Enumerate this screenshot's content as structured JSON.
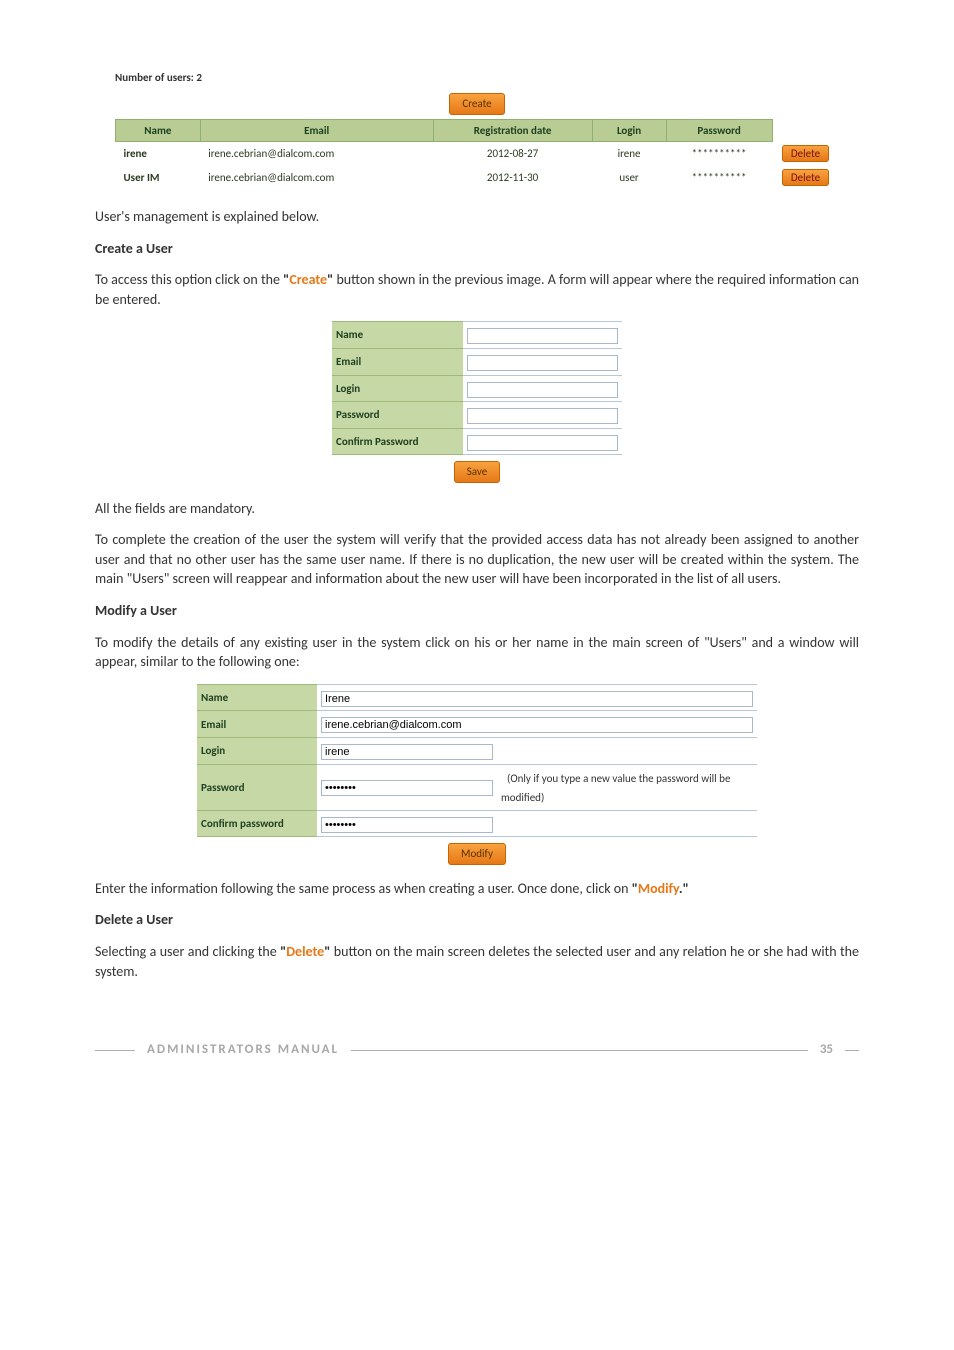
{
  "usersBlock": {
    "numLabel": "Number of users:",
    "numValue": "2",
    "createBtn": "Create",
    "headers": {
      "name": "Name",
      "email": "Email",
      "regDate": "Registration date",
      "login": "Login",
      "password": "Password"
    },
    "rows": [
      {
        "name": "irene",
        "email": "irene.cebrian@dialcom.com",
        "regDate": "2012-08-27",
        "login": "irene",
        "password": "**********",
        "delete": "Delete"
      },
      {
        "name": "User IM",
        "email": "irene.cebrian@dialcom.com",
        "regDate": "2012-11-30",
        "login": "user",
        "password": "**********",
        "delete": "Delete"
      }
    ]
  },
  "text": {
    "explainedBelow": "User's management is explained below.",
    "createHeading": "Create a User",
    "createP1a": "To access this option click on the ",
    "createQuoteOpen": "\"",
    "createWord": "Create",
    "createQuoteClose": "\"",
    "createP1b": " button shown in the previous image. A form will appear where the required information can be entered.",
    "allMandatory": "All the fields are mandatory.",
    "createP2": "To complete the creation of the user the system will verify that the provided access data has not already been assigned to another user and that no other user has the same user name. If there is no duplication, the new user will be created within the system. The main \"Users\" screen will reappear and information about the new user will have been incorporated in the list of all users.",
    "modifyHeading": "Modify a User",
    "modifyP1": "To modify the details of any existing user in the system click on his or her name in the main screen of \"Users\" and a window will appear, similar to the following one:",
    "modifyP2a": "Enter the information following the same process as when creating a user. Once done, click on ",
    "modifyQuoteOpen": "\"",
    "modifyWord": "Modify",
    "modifyDot": ".",
    "modifyQuoteClose": "\"",
    "deleteHeading": "Delete a User",
    "deleteP1a": "Selecting a user and clicking the ",
    "deleteQuoteOpen": "\"",
    "deleteWord": "Delete",
    "deleteQuoteClose": "\"",
    "deleteP1b": " button on the main screen deletes the selected user and any relation he or she had with the system."
  },
  "createForm": {
    "labels": {
      "name": "Name",
      "email": "Email",
      "login": "Login",
      "password": "Password",
      "confirm": "Confirm Password"
    },
    "saveBtn": "Save"
  },
  "modifyForm": {
    "labels": {
      "name": "Name",
      "email": "Email",
      "login": "Login",
      "password": "Password",
      "confirm": "Confirm password"
    },
    "values": {
      "name": "Irene",
      "email": "irene.cebrian@dialcom.com",
      "login": "irene",
      "password": "••••••••",
      "confirm": "••••••••"
    },
    "hint": "(Only if you type a new value the password will be modified)",
    "modifyBtn": "Modify"
  },
  "footer": {
    "title": "ADMINISTRATORS MANUAL",
    "page": "35"
  }
}
